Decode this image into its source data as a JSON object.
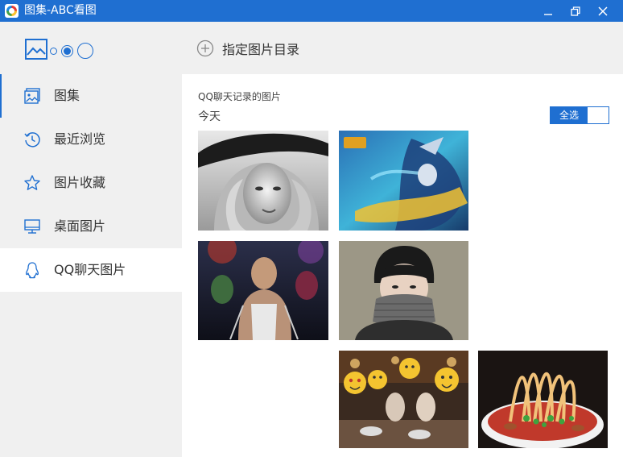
{
  "app": {
    "title": "图集-ABC看图"
  },
  "header": {
    "add_directory_label": "指定图片目录"
  },
  "sidebar": {
    "items": [
      {
        "label": "图集",
        "icon": "album-icon"
      },
      {
        "label": "最近浏览",
        "icon": "history-icon"
      },
      {
        "label": "图片收藏",
        "icon": "star-icon"
      },
      {
        "label": "桌面图片",
        "icon": "monitor-icon"
      },
      {
        "label": "QQ聊天图片",
        "icon": "qq-penguin-icon"
      }
    ],
    "active_index": 4
  },
  "main": {
    "section_title": "QQ聊天记录的图片",
    "date_group": "今天",
    "select_all_label": "全选"
  },
  "colors": {
    "accent": "#1f6fd1",
    "sidebar_bg": "#f0f0f0"
  }
}
